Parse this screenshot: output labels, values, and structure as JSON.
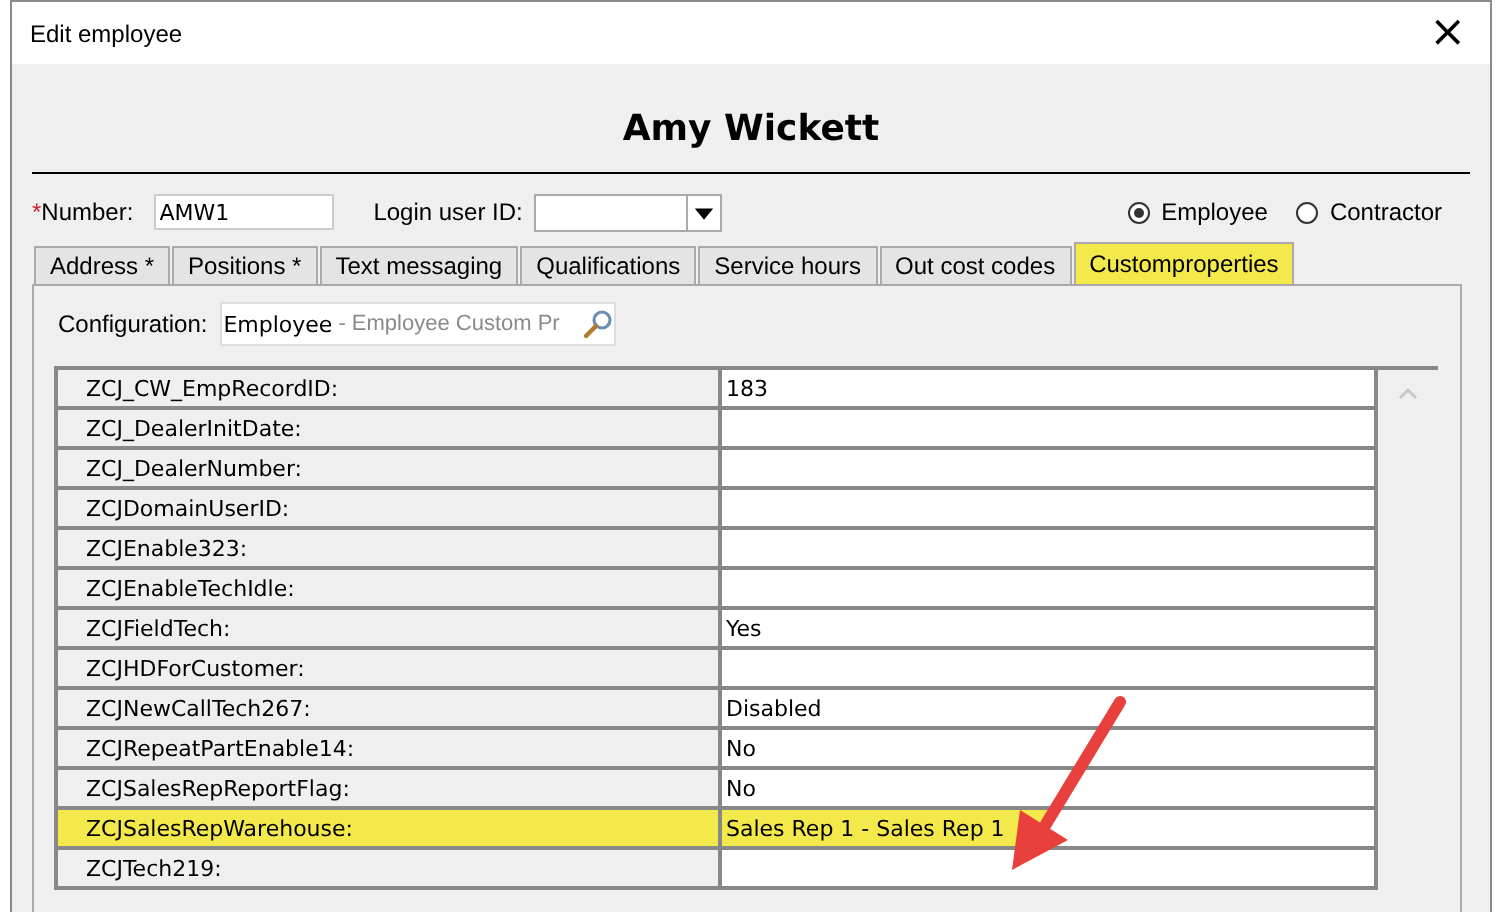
{
  "window": {
    "title": "Edit employee",
    "close": "×"
  },
  "heading": "Amy Wickett",
  "number": {
    "label": "Number:",
    "required_mark": "*",
    "value": "AMW1"
  },
  "login": {
    "label": "Login user ID:"
  },
  "type_options": [
    {
      "label": "Employee",
      "selected": true
    },
    {
      "label": "Contractor",
      "selected": false
    }
  ],
  "tabs": [
    {
      "label": "Address *",
      "selected": false,
      "highlighted": false
    },
    {
      "label": "Positions *",
      "selected": false,
      "highlighted": false
    },
    {
      "label": "Text messaging",
      "selected": false,
      "highlighted": false
    },
    {
      "label": "Qualifications",
      "selected": false,
      "highlighted": false
    },
    {
      "label": "Service hours",
      "selected": false,
      "highlighted": false
    },
    {
      "label": "Out cost codes",
      "selected": false,
      "highlighted": false
    },
    {
      "label": "Customproperties",
      "selected": true,
      "highlighted": true
    }
  ],
  "configuration": {
    "label": "Configuration:",
    "value": "Employee",
    "description": "- Employee Custom Pr"
  },
  "properties": [
    {
      "name": "ZCJ_CW_EmpRecordID:",
      "value": "183",
      "highlighted": false
    },
    {
      "name": "ZCJ_DealerInitDate:",
      "highlighted": false
    },
    {
      "name": "ZCJ_DealerNumber:",
      "highlighted": false
    },
    {
      "name": "ZCJDomainUserID:",
      "highlighted": false
    },
    {
      "name": "ZCJEnable323:",
      "highlighted": false
    },
    {
      "name": "ZCJEnableTechIdle:",
      "highlighted": false
    },
    {
      "name": "ZCJFieldTech:",
      "value": "Yes",
      "highlighted": false
    },
    {
      "name": "ZCJHDForCustomer:",
      "highlighted": false
    },
    {
      "name": "ZCJNewCallTech267:",
      "value": "Disabled",
      "highlighted": false
    },
    {
      "name": "ZCJRepeatPartEnable14:",
      "value": "No",
      "highlighted": false
    },
    {
      "name": "ZCJSalesRepReportFlag:",
      "value": "No",
      "highlighted": false
    },
    {
      "name": "ZCJSalesRepWarehouse:",
      "value": "Sales Rep 1 - Sales Rep 1",
      "highlighted": true
    },
    {
      "name": "ZCJTech219:",
      "highlighted": false
    }
  ]
}
